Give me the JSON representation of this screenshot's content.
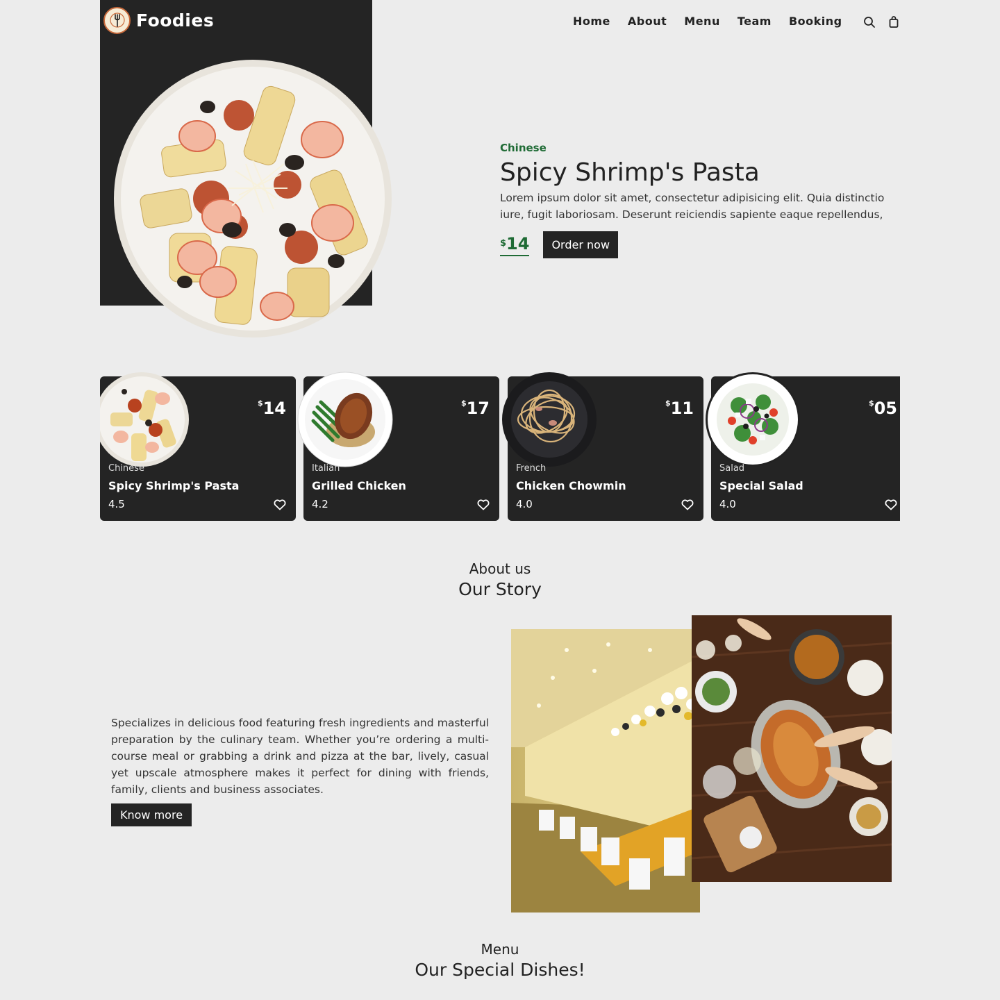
{
  "brand": {
    "name": "Foodies"
  },
  "nav": {
    "items": [
      "Home",
      "About",
      "Menu",
      "Team",
      "Booking"
    ]
  },
  "hero": {
    "category": "Chinese",
    "title": "Spicy Shrimp's Pasta",
    "description_line1": "Lorem ipsum dolor sit amet, consectetur adipisicing elit. Quia distinctio",
    "description_line2": "iure, fugit laboriosam. Deserunt reiciendis sapiente eaque repellendus,",
    "currency": "$",
    "price": "14",
    "order_label": "Order now"
  },
  "cards": [
    {
      "currency": "$",
      "price": "14",
      "category": "Chinese",
      "name": "Spicy Shrimp's Pasta",
      "rating": "4.5"
    },
    {
      "currency": "$",
      "price": "17",
      "category": "Italian",
      "name": "Grilled Chicken",
      "rating": "4.2"
    },
    {
      "currency": "$",
      "price": "11",
      "category": "French",
      "name": "Chicken Chowmin",
      "rating": "4.0"
    },
    {
      "currency": "$",
      "price": "05",
      "category": "Salad",
      "name": "Special Salad",
      "rating": "4.0"
    }
  ],
  "about": {
    "subtitle": "About us",
    "title": "Our Story",
    "body": "Specializes in delicious food featuring fresh ingredients and masterful preparation by the culinary team. Whether you’re ordering a multi-course meal or grabbing a drink and pizza at the bar, lively, casual yet upscale atmosphere makes it perfect for dining with friends, family, clients and business associates.",
    "button_label": "Know more"
  },
  "menu": {
    "subtitle": "Menu",
    "title": "Our Special Dishes!"
  },
  "colors": {
    "dark": "#242424",
    "accent_green": "#1f6b35",
    "background": "#ececec"
  },
  "icons": [
    "fork-logo-icon",
    "search-icon",
    "shopping-bag-icon",
    "heart-icon"
  ]
}
